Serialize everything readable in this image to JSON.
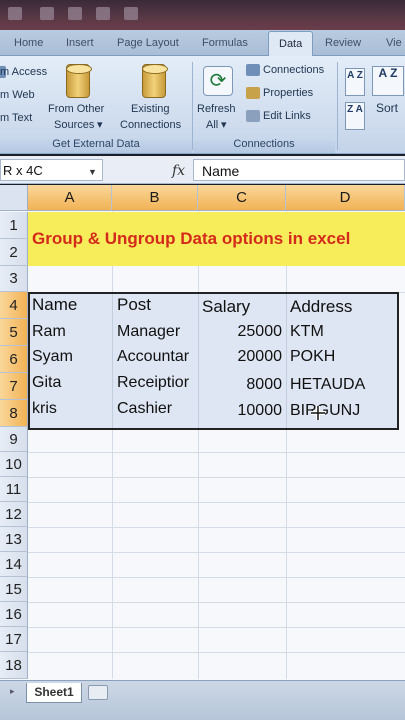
{
  "ribbon": {
    "tabs": [
      "Home",
      "Insert",
      "Page Layout",
      "Formulas",
      "Data",
      "Review",
      "Vie"
    ],
    "active_tab": "Data",
    "external_data": {
      "from_access": "m Access",
      "from_web": "m Web",
      "from_text": "m Text",
      "from_other_sources": [
        "From Other",
        "Sources"
      ],
      "existing_connections": [
        "Existing",
        "Connections"
      ],
      "group_label": "Get External Data"
    },
    "connections": {
      "refresh_all": [
        "Refresh",
        "All"
      ],
      "connections": "Connections",
      "properties": "Properties",
      "edit_links": "Edit Links",
      "group_label": "Connections"
    },
    "sort": {
      "sort_label": "Sort",
      "az": "A Z",
      "za": "Z A"
    }
  },
  "formula_bar": {
    "name_box": "R x 4C",
    "fx": "fx",
    "content": "Name"
  },
  "columns": [
    "A",
    "B",
    "C",
    "D"
  ],
  "rows": [
    "1",
    "2",
    "3",
    "4",
    "5",
    "6",
    "7",
    "8",
    "9",
    "10",
    "11",
    "12",
    "13",
    "14",
    "15",
    "16",
    "17",
    "18"
  ],
  "sheet": {
    "title": "Group & Ungroup Data options in excel",
    "headers": [
      "Name",
      "Post",
      "Salary",
      "Address"
    ],
    "records": [
      {
        "name": "Ram",
        "post": "Manager",
        "salary": "25000",
        "address": "KTM"
      },
      {
        "name": "Syam",
        "post": "Accountar",
        "salary": "20000",
        "address": "POKH"
      },
      {
        "name": "Gita",
        "post": "Receiptior",
        "salary": "8000",
        "address": "HETAUDA"
      },
      {
        "name": "kris",
        "post": "Cashier",
        "salary": "10000",
        "address": "BIRGUNJ"
      }
    ]
  },
  "sheet_tabs": {
    "active": "Sheet1"
  }
}
